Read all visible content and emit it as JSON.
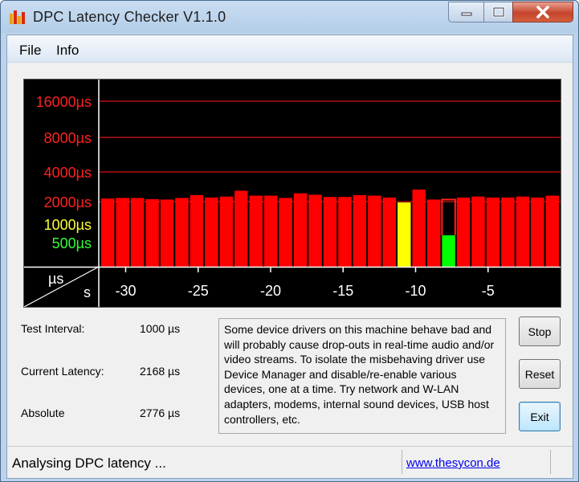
{
  "window": {
    "title": "DPC Latency Checker V1.1.0"
  },
  "menu": {
    "file": "File",
    "info": "Info"
  },
  "graph": {
    "y_labels": [
      {
        "text": "16000µs",
        "color": "#ff2020",
        "value": 16000
      },
      {
        "text": "8000µs",
        "color": "#ff2020",
        "value": 8000
      },
      {
        "text": "4000µs",
        "color": "#ff2020",
        "value": 4000
      },
      {
        "text": "2000µs",
        "color": "#ff2020",
        "value": 2000
      },
      {
        "text": "1000µs",
        "color": "#ffff33",
        "value": 1000
      },
      {
        "text": "500µs",
        "color": "#33ff33",
        "value": 500
      }
    ],
    "corner_us": "µs",
    "corner_s": "s",
    "x_labels": [
      "-30",
      "-25",
      "-20",
      "-15",
      "-10",
      "-5"
    ]
  },
  "chart_data": {
    "type": "bar",
    "x_ticks": [
      -30,
      -25,
      -20,
      -15,
      -10,
      -5
    ],
    "x_range": [
      -31.8,
      0
    ],
    "y_scale": "log2",
    "y_ticks": [
      500,
      1000,
      2000,
      4000,
      8000,
      16000
    ],
    "series": [
      {
        "values": [
          2150,
          2180,
          2180,
          2120,
          2100,
          2180,
          2330,
          2200,
          2250,
          2580,
          2300,
          2300,
          2180,
          2430,
          2350,
          2230,
          2230,
          2330,
          2300,
          2200,
          1950,
          2650,
          2100,
          660,
          2200,
          2250,
          2200,
          2200,
          2250,
          2200,
          2300
        ],
        "colors": [
          "#ff0000",
          "#ff0000",
          "#ff0000",
          "#ff0000",
          "#ff0000",
          "#ff0000",
          "#ff0000",
          "#ff0000",
          "#ff0000",
          "#ff0000",
          "#ff0000",
          "#ff0000",
          "#ff0000",
          "#ff0000",
          "#ff0000",
          "#ff0000",
          "#ff0000",
          "#ff0000",
          "#ff0000",
          "#ff0000",
          "#ffff00",
          "#ff0000",
          "#ff0000",
          "#00ff00",
          "#ff0000",
          "#ff0000",
          "#ff0000",
          "#ff0000",
          "#ff0000",
          "#ff0000",
          "#ff0000"
        ]
      }
    ],
    "peak_marker_index": 23,
    "peak_marker_value": 2100
  },
  "info": {
    "test_interval_label": "Test Interval:",
    "test_interval_value": "1000 µs",
    "current_latency_label": "Current Latency:",
    "current_latency_value": "2168 µs",
    "absolute_label": "Absolute",
    "absolute_value": "2776 µs"
  },
  "message": "Some device drivers on this machine behave bad and will probably cause drop-outs in real-time audio and/or video streams. To isolate the misbehaving driver use Device Manager and disable/re-enable various devices, one at a time. Try network and W-LAN adapters, modems, internal sound devices, USB host controllers, etc.",
  "buttons": {
    "stop": "Stop",
    "reset": "Reset",
    "exit": "Exit"
  },
  "status": {
    "text": "Analysing DPC latency ...",
    "link": "www.thesycon.de"
  },
  "colors": {
    "grid": "#b01010",
    "background": "#000000"
  }
}
